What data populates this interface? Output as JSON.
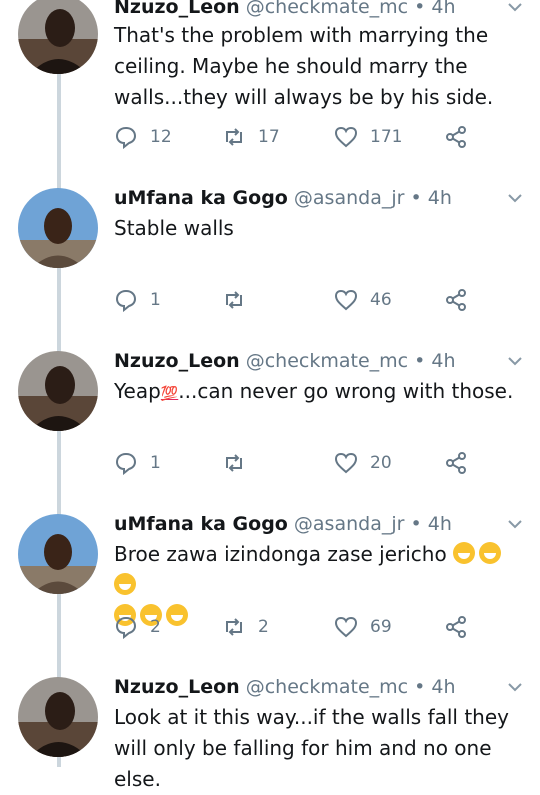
{
  "tweets": [
    {
      "name": "Nzuzo_Leon",
      "handle": "@checkmate_mc",
      "time": "4h",
      "lines": [
        "That's the problem with marrying the",
        "ceiling. Maybe he should marry the",
        "walls...they will always be by his side."
      ],
      "replies": "12",
      "retweets": "17",
      "likes": "171",
      "avatar": "dark"
    },
    {
      "name": "uMfana ka Gogo",
      "handle": "@asanda_jr",
      "time": "4h",
      "lines": [
        "Stable walls"
      ],
      "replies": "1",
      "retweets": "",
      "likes": "46",
      "avatar": "sky"
    },
    {
      "name": "Nzuzo_Leon",
      "handle": "@checkmate_mc",
      "time": "4h",
      "line1_prefix": "Yeap",
      "emoji_100": "💯",
      "line1_suffix": "...can never go wrong with those.",
      "replies": "1",
      "retweets": "",
      "likes": "20",
      "avatar": "dark"
    },
    {
      "name": "uMfana ka Gogo",
      "handle": "@asanda_jr",
      "time": "4h",
      "lines": [
        "Broe zawa izindonga zase jericho"
      ],
      "emoji": "grinning-squinting-face",
      "replies": "2",
      "retweets": "2",
      "likes": "69",
      "avatar": "sky"
    },
    {
      "name": "Nzuzo_Leon",
      "handle": "@checkmate_mc",
      "time": "4h",
      "lines": [
        "Look at it this way...if the walls fall they",
        "will only be falling for him and no one else."
      ],
      "avatar": "dark"
    }
  ],
  "icons": {
    "reply": "reply-icon",
    "retweet": "retweet-icon",
    "like": "heart-icon",
    "share": "share-icon",
    "more": "chevron-down-icon"
  },
  "colors": {
    "text": "#14171a",
    "muted": "#657786",
    "thread": "#ccd6dd"
  }
}
